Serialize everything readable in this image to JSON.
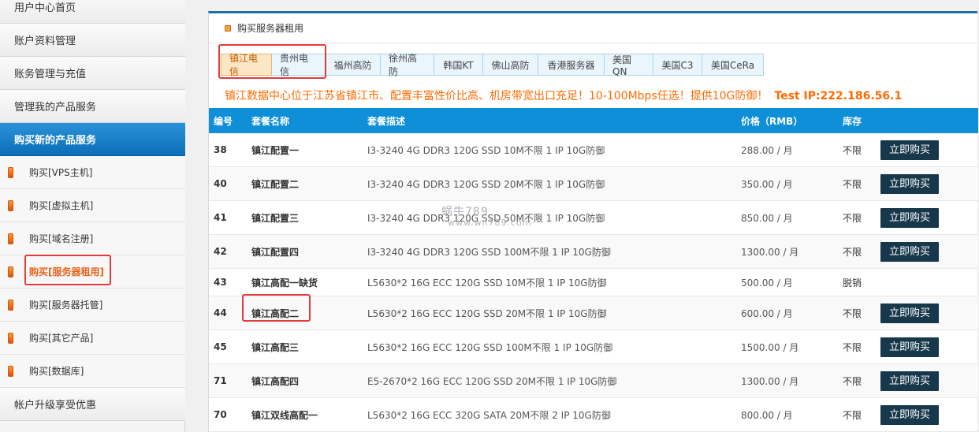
{
  "sidebar": {
    "items": [
      {
        "label": "用户中心首页"
      },
      {
        "label": "账户资料管理"
      },
      {
        "label": "账务管理与充值"
      },
      {
        "label": "管理我的产品服务"
      },
      {
        "label": "购买新的产品服务"
      }
    ],
    "sub_items": [
      {
        "label": "购买[VPS主机]"
      },
      {
        "label": "购买[虚拟主机]"
      },
      {
        "label": "购买[域名注册]"
      },
      {
        "label": "购买[服务器租用]"
      },
      {
        "label": "购买[服务器托管]"
      },
      {
        "label": "购买[其它产品]"
      },
      {
        "label": "购买[数据库]"
      }
    ],
    "footer_item": {
      "label": "帐户升级享受优惠"
    }
  },
  "panel": {
    "title": "购买服务器租用",
    "tabs": [
      "镇江电信",
      "贵州电信",
      "福州高防",
      "徐州高防",
      "韩国KT",
      "佛山高防",
      "香港服务器",
      "美国QN",
      "美国C3",
      "美国CeRa"
    ],
    "active_tab": "镇江电信",
    "notice": "镇江数据中心位于江苏省镇江市、配置丰富性价比高、机房带宽出口充足！10-100Mbps任选！提供10G防御！",
    "notice_ip": "Test IP:222.186.56.1"
  },
  "table": {
    "headers": {
      "id": "编号",
      "name": "套餐名称",
      "desc": "套餐描述",
      "price": "价格（RMB）",
      "stock": "库存"
    },
    "buy_label": "立即购买",
    "rows": [
      {
        "id": "38",
        "name": "镇江配置一",
        "desc": "I3-3240 4G DDR3 120G SSD 10M不限 1 IP 10G防御",
        "price": "288.00 / 月",
        "stock": "不限",
        "buy": true
      },
      {
        "id": "40",
        "name": "镇江配置二",
        "desc": "I3-3240 4G DDR3 120G SSD 20M不限 1 IP 10G防御",
        "price": "350.00 / 月",
        "stock": "不限",
        "buy": true
      },
      {
        "id": "41",
        "name": "镇江配置三",
        "desc": "I3-3240 4G DDR3 120G SSD 50M不限 1 IP 10G防御",
        "price": "850.00 / 月",
        "stock": "不限",
        "buy": true
      },
      {
        "id": "42",
        "name": "镇江配置四",
        "desc": "I3-3240 4G DDR3 120G SSD 100M不限 1 IP 10G防御",
        "price": "1300.00 / 月",
        "stock": "不限",
        "buy": true
      },
      {
        "id": "43",
        "name": "镇江高配一缺货",
        "desc": "L5630*2 16G ECC 120G SSD 10M不限 1 IP 10G防御",
        "price": "500.00 / 月",
        "stock": "脱销",
        "buy": false
      },
      {
        "id": "44",
        "name": "镇江高配二",
        "desc": "L5630*2 16G ECC 120G SSD 20M不限 1 IP 10G防御",
        "price": "600.00 / 月",
        "stock": "不限",
        "buy": true
      },
      {
        "id": "45",
        "name": "镇江高配三",
        "desc": "L5630*2 16G ECC 120G SSD 100M不限 1 IP 10G防御",
        "price": "1500.00 / 月",
        "stock": "不限",
        "buy": true
      },
      {
        "id": "71",
        "name": "镇江高配四",
        "desc": "E5-2670*2 16G ECC 120G SSD 20M不限 1 IP 10G防御",
        "price": "1300.00 / 月",
        "stock": "不限",
        "buy": true
      },
      {
        "id": "70",
        "name": "镇江双线高配一",
        "desc": "L5630*2 16G ECC 320G SATA 20M不限 2 IP 10G防御",
        "price": "800.00 / 月",
        "stock": "不限",
        "buy": true
      }
    ]
  },
  "watermark": {
    "line1": "蜗牛789",
    "line2": "www.wn789.com"
  }
}
